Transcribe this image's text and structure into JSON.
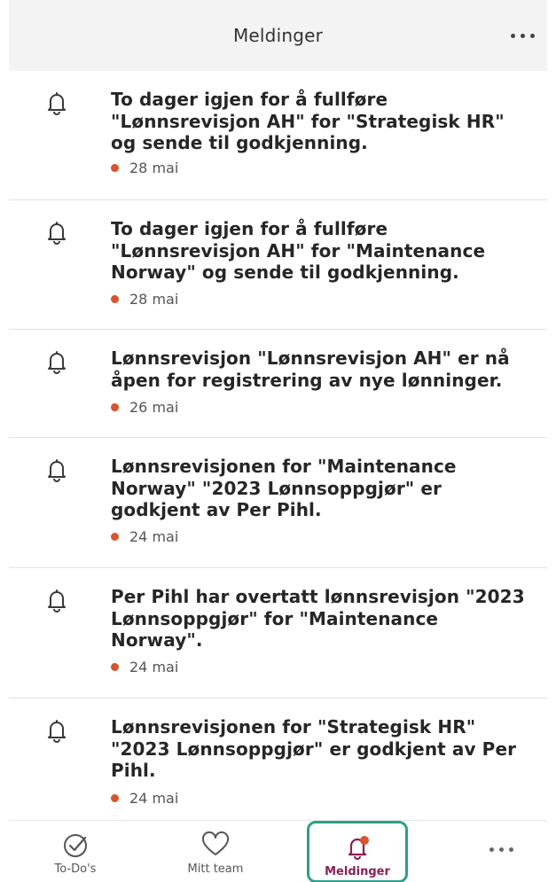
{
  "header": {
    "title": "Meldinger",
    "more_icon": "more-horizontal-icon"
  },
  "notifications": [
    {
      "text": "To dager igjen for å fullføre \"Lønnsrevisjon AH\" for \"Strategisk HR\" og sende til godkjenning.",
      "date": "28 mai",
      "unread": true
    },
    {
      "text": "To dager igjen for å fullføre \"Lønnsrevisjon AH\" for \"Maintenance Norway\" og sende til godkjenning.",
      "date": "28 mai",
      "unread": true
    },
    {
      "text": "Lønnsrevisjon \"Lønnsrevisjon AH\" er nå åpen for registrering av nye lønninger.",
      "date": "26 mai",
      "unread": true
    },
    {
      "text": "Lønnsrevisjonen for \"Maintenance Norway\" \"2023 Lønnsoppgjør\" er godkjent av Per Pihl.",
      "date": "24 mai",
      "unread": true
    },
    {
      "text": "Per Pihl har overtatt lønnsrevisjon \"2023 Lønnsoppgjør\" for \"Maintenance Norway\".",
      "date": "24 mai",
      "unread": true
    },
    {
      "text": "Lønnsrevisjonen for \"Strategisk HR\" \"2023 Lønnsoppgjør\" er godkjent av Per Pihl.",
      "date": "24 mai",
      "unread": true
    }
  ],
  "tabbar": {
    "tabs": [
      {
        "label": "To-Do's",
        "icon": "check-circle-icon"
      },
      {
        "label": "Mitt team",
        "icon": "heart-icon"
      },
      {
        "label": "Meldinger",
        "icon": "bell-icon",
        "active": true
      }
    ],
    "more_icon": "more-horizontal-icon"
  },
  "colors": {
    "unread_dot": "#d9532c",
    "active_tab_label": "#8a1f56",
    "active_tab_border": "#2f9e8a",
    "header_bg": "#f3f3f4"
  }
}
